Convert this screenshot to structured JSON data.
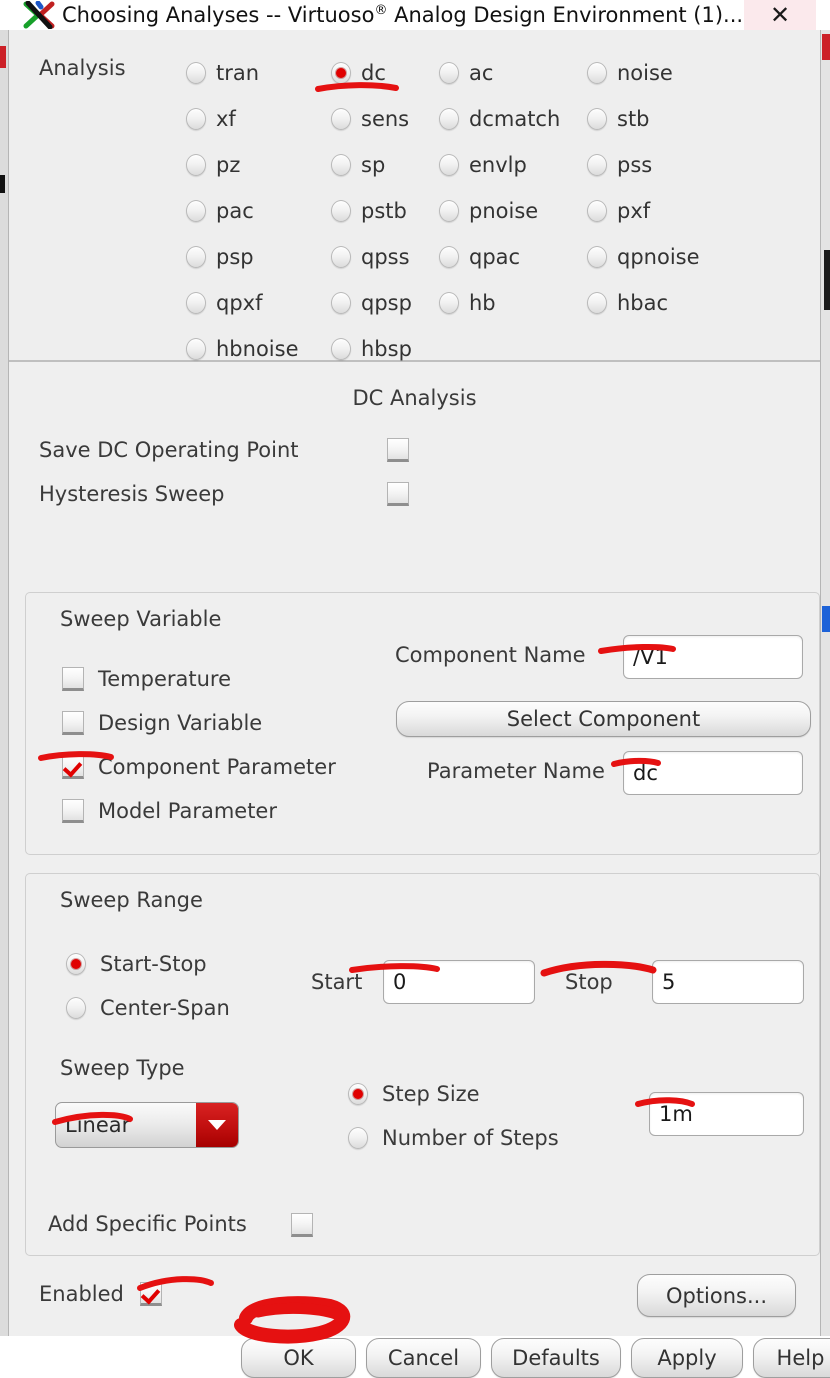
{
  "window": {
    "title": "Choosing Analyses -- Virtuoso® Analog Design Environment (1)...",
    "title_main": "Choosing Analyses -- Virtuoso",
    "title_reg": "®",
    "title_rest": " Analog Design Environment (1)...",
    "close_label": "✕",
    "app_icon": "x-logo-icon"
  },
  "analysis": {
    "label": "Analysis",
    "selected": "dc",
    "rows": [
      [
        {
          "id": "tran",
          "label": "tran"
        },
        {
          "id": "dc",
          "label": "dc"
        },
        {
          "id": "ac",
          "label": "ac"
        },
        {
          "id": "noise",
          "label": "noise"
        }
      ],
      [
        {
          "id": "xf",
          "label": "xf"
        },
        {
          "id": "sens",
          "label": "sens"
        },
        {
          "id": "dcmatch",
          "label": "dcmatch"
        },
        {
          "id": "stb",
          "label": "stb"
        }
      ],
      [
        {
          "id": "pz",
          "label": "pz"
        },
        {
          "id": "sp",
          "label": "sp"
        },
        {
          "id": "envlp",
          "label": "envlp"
        },
        {
          "id": "pss",
          "label": "pss"
        }
      ],
      [
        {
          "id": "pac",
          "label": "pac"
        },
        {
          "id": "pstb",
          "label": "pstb"
        },
        {
          "id": "pnoise",
          "label": "pnoise"
        },
        {
          "id": "pxf",
          "label": "pxf"
        }
      ],
      [
        {
          "id": "psp",
          "label": "psp"
        },
        {
          "id": "qpss",
          "label": "qpss"
        },
        {
          "id": "qpac",
          "label": "qpac"
        },
        {
          "id": "qpnoise",
          "label": "qpnoise"
        }
      ],
      [
        {
          "id": "qpxf",
          "label": "qpxf"
        },
        {
          "id": "qpsp",
          "label": "qpsp"
        },
        {
          "id": "hb",
          "label": "hb"
        },
        {
          "id": "hbac",
          "label": "hbac"
        }
      ],
      [
        {
          "id": "hbnoise",
          "label": "hbnoise"
        },
        {
          "id": "hbsp",
          "label": "hbsp"
        }
      ]
    ]
  },
  "dc_section": {
    "heading": "DC Analysis",
    "save_dc_operating_point": {
      "label": "Save DC Operating Point",
      "checked": false
    },
    "hysteresis_sweep": {
      "label": "Hysteresis Sweep",
      "checked": false
    }
  },
  "sweep_variable": {
    "title": "Sweep Variable",
    "options": [
      {
        "label": "Temperature",
        "checked": false
      },
      {
        "label": "Design Variable",
        "checked": false
      },
      {
        "label": "Component Parameter",
        "checked": true
      },
      {
        "label": "Model Parameter",
        "checked": false
      }
    ],
    "component_name_label": "Component Name",
    "component_name_value": "/V1",
    "select_component_button": "Select Component",
    "parameter_name_label": "Parameter Name",
    "parameter_name_value": "dc"
  },
  "sweep_range": {
    "title": "Sweep Range",
    "mode_selected": "Start-Stop",
    "modes": [
      {
        "label": "Start-Stop",
        "selected": true
      },
      {
        "label": "Center-Span",
        "selected": false
      }
    ],
    "start_label": "Start",
    "start_value": "0",
    "stop_label": "Stop",
    "stop_value": "5",
    "sweep_type_label": "Sweep Type",
    "sweep_type_value": "Linear",
    "step_mode": [
      {
        "label": "Step Size",
        "selected": true
      },
      {
        "label": "Number of Steps",
        "selected": false
      }
    ],
    "step_size_value": "1m",
    "add_specific_points_label": "Add Specific Points",
    "add_specific_points_checked": false
  },
  "footer": {
    "enabled_label": "Enabled",
    "enabled_checked": true,
    "options_button": "Options...",
    "buttons": [
      {
        "id": "ok",
        "label": "OK"
      },
      {
        "id": "cancel",
        "label": "Cancel"
      },
      {
        "id": "defaults",
        "label": "Defaults"
      },
      {
        "id": "apply",
        "label": "Apply"
      },
      {
        "id": "help",
        "label": "Help"
      }
    ]
  },
  "annotations": {
    "color": "#e51111",
    "marks": [
      "underline-dc-radio",
      "underline-component-name-value",
      "underline-component-parameter-checkbox",
      "underline-parameter-name-value",
      "underline-start-value",
      "underline-stop-value",
      "underline-sweep-type-dropdown",
      "underline-step-size-value",
      "underline-enabled-checkbox",
      "circle-ok-button"
    ]
  }
}
